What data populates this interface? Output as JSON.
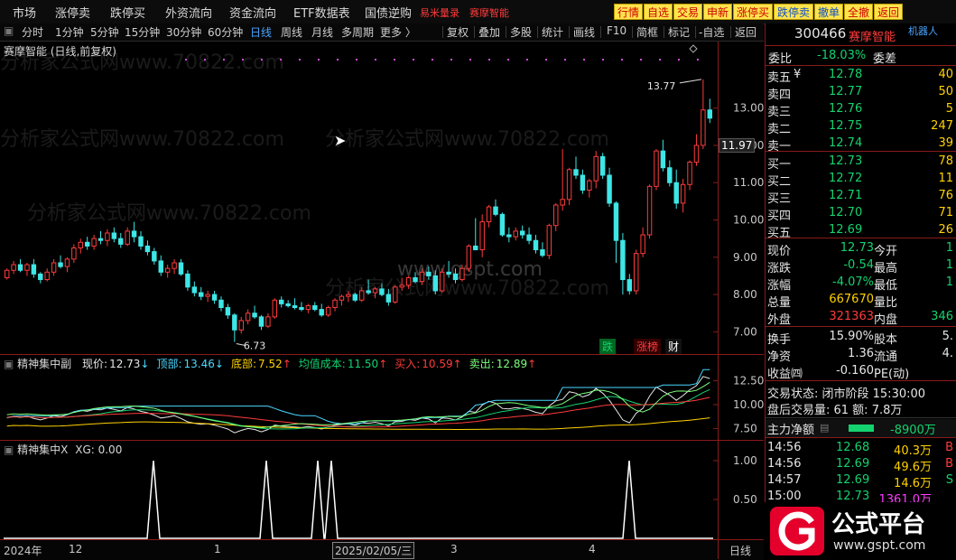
{
  "menu": {
    "items": [
      "市场",
      "涨停卖",
      "跌停买",
      "外资流向",
      "资金流向",
      "ETF数据表",
      "国债逆购"
    ],
    "red_links": [
      "易米量录",
      "赛摩智能"
    ],
    "buttons": [
      "行情",
      "自选",
      "交易",
      "申新",
      "涨停买",
      "跌停卖",
      "撤单",
      "全撤",
      "返回"
    ]
  },
  "periods": [
    "分时",
    "1分钟",
    "5分钟",
    "15分钟",
    "30分钟",
    "60分钟",
    "日线",
    "周线",
    "月线",
    "多周期",
    "更多 〉"
  ],
  "active_period": "日线",
  "tools": [
    "复权",
    "叠加",
    "多股",
    "统计",
    "画线",
    "F10",
    "简框",
    "标记",
    "-自选",
    "返回"
  ],
  "chart": {
    "title": "赛摩智能 (日线,前复权)",
    "yticks": [
      "13.00",
      "12.00",
      "11.00",
      "10.00",
      "9.00",
      "8.00",
      "7.00"
    ],
    "price_tag": "11.97",
    "high_label": "13.77",
    "low_label": "6.73",
    "badges": [
      {
        "text": "跌",
        "color": "#14d26e"
      },
      {
        "text": "涨榜",
        "color": "#ff3b3b"
      },
      {
        "text": "财",
        "color": "#ffffff"
      }
    ],
    "watermark_site": "www.gspt.com",
    "watermark_text": "分析家公式网www.70822.com"
  },
  "ind1": {
    "name": "精神集中副",
    "items": [
      {
        "label": "现价:",
        "value": "12.73",
        "arrow": "↓",
        "color": "#e6e6e6"
      },
      {
        "label": "顶部:",
        "value": "13.46",
        "arrow": "↓",
        "color": "#4ad8ff"
      },
      {
        "label": "底部:",
        "value": "7.52",
        "arrow": "↑",
        "color": "#ffd200"
      },
      {
        "label": "均值成本:",
        "value": "11.50",
        "arrow": "↑",
        "color": "#14d26e"
      },
      {
        "label": "买入:",
        "value": "10.59",
        "arrow": "↑",
        "color": "#ff3b3b"
      },
      {
        "label": "卖出:",
        "value": "12.89",
        "arrow": "↑",
        "color": "#7cff7c"
      }
    ],
    "yticks": [
      "12.50",
      "10.00",
      "7.50"
    ]
  },
  "ind2": {
    "name": "精神集中X",
    "xg_label": "XG: 0.00",
    "yticks": [
      "1.00",
      "0.50"
    ]
  },
  "xaxis": {
    "labels": [
      "2024年",
      "12",
      "1",
      "2025/02/05/三",
      "3",
      "4"
    ],
    "period": "日线"
  },
  "quote": {
    "code": "300466",
    "name": "赛摩智能",
    "tag": "机器人",
    "webi_label": "委比",
    "webi_value": "-18.03%",
    "weicha_label": "委差",
    "asks": [
      {
        "label": "卖五",
        "mark": "¥",
        "price": "12.78",
        "vol": "40"
      },
      {
        "label": "卖四",
        "mark": "",
        "price": "12.77",
        "vol": "50"
      },
      {
        "label": "卖三",
        "mark": "",
        "price": "12.76",
        "vol": "5"
      },
      {
        "label": "卖二",
        "mark": "",
        "price": "12.75",
        "vol": "247"
      },
      {
        "label": "卖一",
        "mark": "",
        "price": "12.74",
        "vol": "39"
      }
    ],
    "bids": [
      {
        "label": "买一",
        "price": "12.73",
        "vol": "78"
      },
      {
        "label": "买二",
        "price": "12.72",
        "vol": "11"
      },
      {
        "label": "买三",
        "price": "12.71",
        "vol": "76"
      },
      {
        "label": "买四",
        "price": "12.70",
        "vol": "71"
      },
      {
        "label": "买五",
        "price": "12.69",
        "vol": "26"
      }
    ],
    "stats": [
      {
        "l1": "现价",
        "v1": "12.73",
        "c1": "#14d26e",
        "l2": "今开",
        "v2": "1"
      },
      {
        "l1": "涨跌",
        "v1": "-0.54",
        "c1": "#14d26e",
        "l2": "最高",
        "v2": "1"
      },
      {
        "l1": "涨幅",
        "v1": "-4.07%",
        "c1": "#14d26e",
        "l2": "最低",
        "v2": "1"
      },
      {
        "l1": "总量",
        "v1": "667670",
        "c1": "#ffd200",
        "l2": "量比",
        "v2": ""
      },
      {
        "l1": "外盘",
        "v1": "321363",
        "c1": "#ff3b3b",
        "l2": "内盘",
        "v2": "346"
      }
    ],
    "stats2": [
      {
        "l1": "换手",
        "v1": "15.90%",
        "l2": "股本",
        "v2": "5."
      },
      {
        "l1": "净资",
        "v1": "1.36",
        "l2": "流通",
        "v2": "4."
      },
      {
        "l1": "收益㈣",
        "v1": "-0.160",
        "l2": "PE(动)",
        "v2": ""
      }
    ],
    "trade_state": "交易状态: 闭市阶段 15:30:00",
    "after_hours": "盘后交易量: 61  额: 7.8万",
    "net_flow_label": "主力净额",
    "net_flow_value": "-8900万",
    "ticks": [
      {
        "time": "14:56",
        "price": "12.68",
        "vol": "40.3万",
        "side": "B"
      },
      {
        "time": "14:56",
        "price": "12.69",
        "vol": "49.6万",
        "side": "B"
      },
      {
        "time": "14:57",
        "price": "12.69",
        "vol": "14.6万",
        "side": "S"
      },
      {
        "time": "15:00",
        "price": "12.73",
        "vol": "1361.0万",
        "side": ""
      }
    ]
  },
  "logo": {
    "main": "公式平台",
    "sub": "www.gspt.com"
  },
  "colors": {
    "up": "#ff3b3b",
    "down": "#14d26e",
    "candle_down": "#3ee6e6",
    "border": "#8a1a1a"
  },
  "chart_data": {
    "type": "candlestick",
    "ylim": [
      6.5,
      14.3
    ],
    "y_scale": "linear",
    "candles": [
      [
        8.45,
        8.7,
        8.4,
        8.65
      ],
      [
        8.65,
        8.9,
        8.55,
        8.8
      ],
      [
        8.8,
        8.95,
        8.6,
        8.65
      ],
      [
        8.65,
        8.85,
        8.5,
        8.8
      ],
      [
        8.8,
        8.95,
        8.45,
        8.55
      ],
      [
        8.55,
        8.6,
        8.3,
        8.4
      ],
      [
        8.4,
        8.7,
        8.35,
        8.6
      ],
      [
        8.6,
        8.95,
        8.5,
        8.85
      ],
      [
        8.85,
        9.05,
        8.7,
        8.75
      ],
      [
        8.75,
        9.0,
        8.6,
        8.95
      ],
      [
        8.95,
        9.35,
        8.85,
        9.25
      ],
      [
        9.25,
        9.5,
        9.1,
        9.4
      ],
      [
        9.4,
        9.55,
        9.2,
        9.3
      ],
      [
        9.3,
        9.6,
        9.2,
        9.5
      ],
      [
        9.5,
        9.7,
        9.35,
        9.45
      ],
      [
        9.45,
        9.75,
        9.3,
        9.65
      ],
      [
        9.65,
        9.8,
        9.4,
        9.5
      ],
      [
        9.5,
        9.65,
        9.25,
        9.35
      ],
      [
        9.35,
        9.8,
        9.3,
        9.7
      ],
      [
        9.7,
        9.95,
        9.4,
        9.55
      ],
      [
        9.55,
        9.7,
        9.2,
        9.3
      ],
      [
        9.3,
        9.45,
        9.05,
        9.15
      ],
      [
        9.15,
        9.25,
        8.8,
        8.9
      ],
      [
        8.9,
        9.05,
        8.5,
        8.6
      ],
      [
        8.6,
        8.8,
        8.45,
        8.7
      ],
      [
        8.7,
        8.95,
        8.55,
        8.85
      ],
      [
        8.85,
        8.95,
        8.5,
        8.55
      ],
      [
        8.55,
        8.65,
        8.1,
        8.2
      ],
      [
        8.2,
        8.35,
        7.95,
        8.05
      ],
      [
        8.05,
        8.2,
        7.85,
        7.95
      ],
      [
        7.95,
        8.1,
        7.8,
        8.0
      ],
      [
        8.0,
        8.1,
        7.75,
        7.85
      ],
      [
        7.85,
        7.95,
        7.55,
        7.65
      ],
      [
        7.65,
        7.75,
        7.35,
        7.45
      ],
      [
        7.45,
        7.5,
        6.73,
        7.05
      ],
      [
        7.05,
        7.4,
        6.95,
        7.3
      ],
      [
        7.3,
        7.6,
        7.2,
        7.5
      ],
      [
        7.5,
        7.7,
        7.35,
        7.4
      ],
      [
        7.4,
        7.45,
        7.05,
        7.15
      ],
      [
        7.15,
        7.5,
        7.1,
        7.4
      ],
      [
        7.4,
        7.9,
        7.35,
        7.85
      ],
      [
        7.85,
        7.95,
        7.65,
        7.75
      ],
      [
        7.75,
        7.85,
        7.65,
        7.7
      ],
      [
        7.7,
        7.9,
        7.6,
        7.65
      ],
      [
        7.65,
        7.8,
        7.55,
        7.6
      ],
      [
        7.6,
        7.75,
        7.5,
        7.7
      ],
      [
        7.7,
        7.8,
        7.55,
        7.6
      ],
      [
        7.6,
        7.75,
        7.4,
        7.45
      ],
      [
        7.45,
        7.7,
        7.4,
        7.65
      ],
      [
        7.65,
        7.9,
        7.55,
        7.85
      ],
      [
        7.85,
        8.0,
        7.7,
        7.95
      ],
      [
        7.95,
        8.1,
        7.8,
        8.0
      ],
      [
        8.0,
        8.05,
        7.8,
        7.85
      ],
      [
        7.85,
        8.2,
        7.8,
        8.1
      ],
      [
        8.1,
        8.4,
        8.0,
        8.05
      ],
      [
        8.05,
        8.2,
        7.9,
        8.15
      ],
      [
        8.15,
        8.3,
        7.95,
        8.0
      ],
      [
        8.0,
        8.15,
        7.7,
        7.8
      ],
      [
        7.8,
        8.25,
        7.75,
        8.2
      ],
      [
        8.2,
        8.45,
        8.1,
        8.25
      ],
      [
        8.25,
        8.5,
        8.15,
        8.45
      ],
      [
        8.45,
        8.6,
        8.3,
        8.35
      ],
      [
        8.35,
        8.7,
        8.25,
        8.6
      ],
      [
        8.6,
        8.75,
        8.4,
        8.5
      ],
      [
        8.5,
        8.65,
        8.0,
        8.1
      ],
      [
        8.1,
        8.7,
        8.05,
        8.6
      ],
      [
        8.6,
        8.9,
        8.45,
        8.55
      ],
      [
        8.55,
        8.7,
        8.3,
        8.4
      ],
      [
        8.4,
        8.8,
        8.35,
        8.7
      ],
      [
        8.7,
        9.35,
        8.6,
        9.3
      ],
      [
        9.3,
        10.05,
        9.2,
        9.2
      ],
      [
        9.2,
        10.15,
        9.0,
        9.95
      ],
      [
        9.95,
        10.4,
        9.8,
        10.35
      ],
      [
        10.35,
        10.55,
        10.1,
        10.15
      ],
      [
        10.15,
        10.2,
        9.55,
        9.6
      ],
      [
        9.6,
        9.8,
        9.4,
        9.55
      ],
      [
        9.55,
        9.8,
        9.45,
        9.7
      ],
      [
        9.7,
        9.85,
        9.5,
        9.6
      ],
      [
        9.6,
        9.8,
        9.35,
        9.45
      ],
      [
        9.45,
        9.6,
        9.1,
        9.2
      ],
      [
        9.2,
        9.4,
        9.0,
        9.05
      ],
      [
        9.05,
        9.9,
        8.95,
        9.85
      ],
      [
        9.85,
        10.45,
        9.7,
        10.4
      ],
      [
        10.4,
        11.9,
        10.25,
        10.55
      ],
      [
        10.55,
        11.4,
        10.4,
        11.35
      ],
      [
        11.35,
        11.7,
        11.1,
        11.2
      ],
      [
        11.2,
        11.35,
        10.7,
        10.8
      ],
      [
        10.8,
        11.1,
        10.6,
        11.05
      ],
      [
        11.05,
        11.85,
        10.85,
        11.7
      ],
      [
        11.7,
        11.8,
        11.1,
        11.2
      ],
      [
        11.2,
        11.4,
        10.35,
        10.45
      ],
      [
        10.45,
        10.5,
        8.85,
        9.45
      ],
      [
        9.45,
        9.65,
        8.0,
        8.4
      ],
      [
        8.4,
        8.55,
        8.0,
        8.1
      ],
      [
        8.1,
        9.2,
        8.0,
        9.1
      ],
      [
        9.1,
        9.8,
        9.0,
        9.6
      ],
      [
        9.6,
        10.95,
        9.5,
        10.9
      ],
      [
        10.9,
        11.9,
        10.8,
        11.85
      ],
      [
        11.85,
        12.15,
        11.3,
        11.4
      ],
      [
        11.4,
        11.6,
        10.9,
        11.0
      ],
      [
        11.0,
        11.35,
        10.3,
        10.45
      ],
      [
        10.45,
        11.1,
        10.2,
        10.95
      ],
      [
        10.95,
        11.6,
        10.8,
        11.55
      ],
      [
        11.55,
        12.3,
        11.45,
        12.0
      ],
      [
        12.0,
        13.77,
        11.9,
        12.95
      ],
      [
        12.95,
        13.25,
        12.6,
        12.73
      ]
    ]
  }
}
